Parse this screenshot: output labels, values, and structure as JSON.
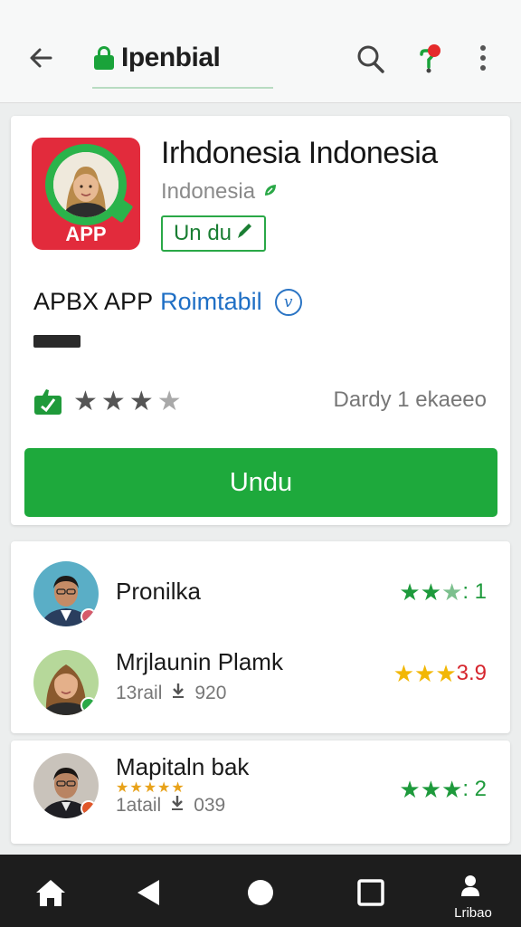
{
  "header": {
    "title": "Ipenbial",
    "icons": [
      "back-arrow-icon",
      "lock-icon",
      "search-icon",
      "notification-icon",
      "more-vert-icon"
    ]
  },
  "app": {
    "name": "Irhdonesia Indonesia",
    "developer": "Indonesia",
    "icon_label": "APP",
    "install_pill": "Un du",
    "subtitle_main": "APBX APP",
    "subtitle_link": "Roimtabil",
    "subtitle_badge": "v",
    "rating_stars_filled": 3,
    "rating_stars_total": 4,
    "rating_note": "Dardy 1 ekaeeo",
    "primary_button": "Undu"
  },
  "reviews": [
    {
      "name": "Pronilka",
      "meta": "",
      "meta_value": "",
      "score": ": 1",
      "score_color": "#1e9a3c",
      "stars": 2.5
    },
    {
      "name": "Mrjlaunin Plamk",
      "meta": "13rail",
      "meta_value": "920",
      "score": "3.9",
      "score_color": "#d6262e",
      "stars": 2.5
    },
    {
      "name": "Mapitaln bak",
      "meta": "1atail",
      "meta_value": "039",
      "score": ": 2",
      "score_color": "#1e9a3c",
      "stars": 2.5
    }
  ],
  "navbar": {
    "label": "Lribao",
    "icons": [
      "home-icon",
      "back-triangle-icon",
      "home-circle-icon",
      "recents-square-icon",
      "profile-icon"
    ]
  },
  "colors": {
    "primary_green": "#1ea93c",
    "icon_red": "#e22b3c",
    "link_blue": "#1f6fc5",
    "gold_star": "#f2b705"
  }
}
